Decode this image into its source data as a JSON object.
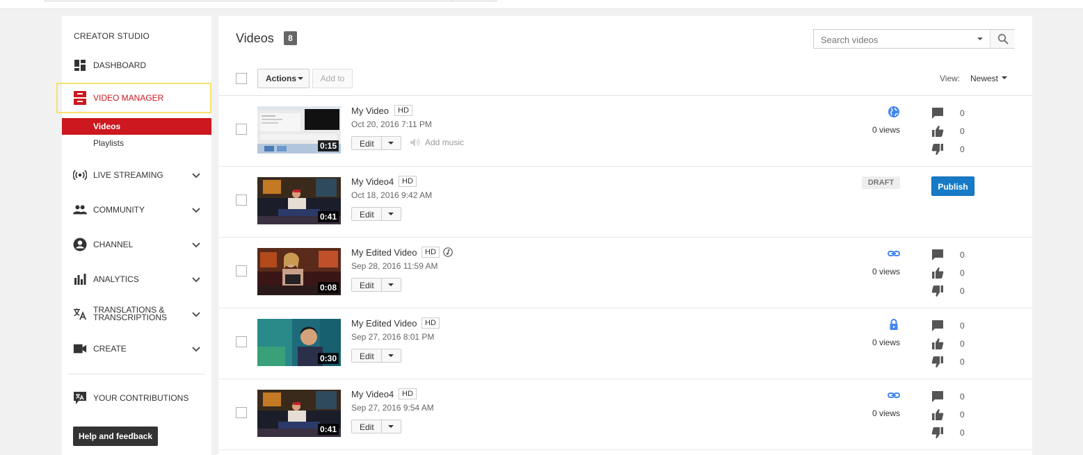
{
  "sidebar": {
    "title": "CREATOR STUDIO",
    "items": [
      {
        "label": "DASHBOARD",
        "icon": "dashboard-icon"
      },
      {
        "label": "VIDEO MANAGER",
        "icon": "video-manager-icon",
        "active": true
      },
      {
        "label": "LIVE STREAMING",
        "icon": "live-streaming-icon"
      },
      {
        "label": "COMMUNITY",
        "icon": "community-icon"
      },
      {
        "label": "CHANNEL",
        "icon": "channel-icon"
      },
      {
        "label": "ANALYTICS",
        "icon": "analytics-icon"
      },
      {
        "label": "TRANSLATIONS & TRANSCRIPTIONS",
        "icon": "translate-icon"
      },
      {
        "label": "CREATE",
        "icon": "create-icon"
      },
      {
        "label": "YOUR CONTRIBUTIONS",
        "icon": "contributions-icon"
      }
    ],
    "sub_items": [
      {
        "label": "Videos",
        "selected": true
      },
      {
        "label": "Playlists"
      }
    ],
    "help_label": "Help and feedback"
  },
  "main": {
    "title": "Videos",
    "count": "8",
    "search_placeholder": "Search videos",
    "actions_label": "Actions",
    "add_to_label": "Add to",
    "view_label": "View:",
    "view_value": "Newest",
    "edit_label": "Edit",
    "add_music_label": "Add music",
    "draft_label": "DRAFT",
    "publish_label": "Publish"
  },
  "videos": [
    {
      "title": "My Video",
      "hd": "HD",
      "date": "Oct 20, 2016 7:11 PM",
      "duration": "0:15",
      "visibility": "globe-icon",
      "views": "0 views",
      "comments": "0",
      "likes": "0",
      "dislikes": "0"
    },
    {
      "title": "My Video4",
      "hd": "HD",
      "date": "Oct 18, 2016 9:42 AM",
      "duration": "0:41",
      "status": "DRAFT"
    },
    {
      "title": "My Edited Video",
      "hd": "HD",
      "date": "Sep 28, 2016 11:59 AM",
      "duration": "0:08",
      "visibility": "link-icon",
      "views": "0 views",
      "comments": "0",
      "likes": "0",
      "dislikes": "0"
    },
    {
      "title": "My Edited Video",
      "hd": "HD",
      "date": "Sep 27, 2016 8:01 PM",
      "duration": "0:30",
      "visibility": "lock-icon",
      "views": "0 views",
      "comments": "0",
      "likes": "0",
      "dislikes": "0"
    },
    {
      "title": "My Video4",
      "hd": "HD",
      "date": "Sep 27, 2016 9:54 AM",
      "duration": "0:41",
      "visibility": "link-icon",
      "views": "0 views",
      "comments": "0",
      "likes": "0",
      "dislikes": "0"
    }
  ],
  "colors": {
    "accent_red": "#cc181e",
    "publish_blue": "#167ac6",
    "icon_blue": "#4285f4",
    "highlight_yellow": "#f9e26c"
  }
}
